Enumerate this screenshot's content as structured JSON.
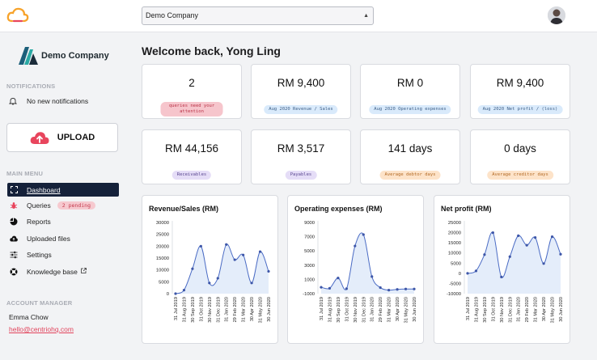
{
  "topbar": {
    "company_select_value": "Demo Company"
  },
  "sidebar": {
    "brand_name": "Demo Company",
    "notifications_label": "NOTIFICATIONS",
    "notification_text": "No new notifications",
    "upload_label": "UPLOAD",
    "main_menu_label": "MAIN MENU",
    "menu": [
      {
        "label": "Dashboard",
        "icon": "dashboard-icon"
      },
      {
        "label": "Queries",
        "icon": "bug-icon",
        "badge": "2 pending"
      },
      {
        "label": "Reports",
        "icon": "pie-chart-icon"
      },
      {
        "label": "Uploaded files",
        "icon": "cloud-icon"
      },
      {
        "label": "Settings",
        "icon": "sliders-icon"
      },
      {
        "label": "Knowledge base",
        "icon": "help-icon"
      }
    ],
    "account_manager_label": "ACCOUNT MANAGER",
    "manager_name": "Emma Chow",
    "manager_email": "hello@centriohq.com"
  },
  "welcome": "Welcome back, Yong Ling",
  "kpis": [
    {
      "value": "2",
      "tag": "queries need your attention",
      "color": "#f6c5cc"
    },
    {
      "value": "RM 9,400",
      "tag": "Aug 2020 Revenue / Sales",
      "color": "#d9eafb"
    },
    {
      "value": "RM 0",
      "tag": "Aug 2020 Operating expenses",
      "color": "#d9eafb"
    },
    {
      "value": "RM 9,400",
      "tag": "Aug 2020 Net profit / (loss)",
      "color": "#d9eafb"
    },
    {
      "value": "RM 44,156",
      "tag": "Receivables",
      "color": "#e5ddf7"
    },
    {
      "value": "RM 3,517",
      "tag": "Payables",
      "color": "#e5ddf7"
    },
    {
      "value": "141 days",
      "tag": "Average debtor days",
      "color": "#fde3c9"
    },
    {
      "value": "0 days",
      "tag": "Average creditor days",
      "color": "#fde3c9"
    }
  ],
  "chart_data": [
    {
      "type": "area",
      "title": "Revenue/Sales (RM)",
      "x": [
        "31 Jul 2019",
        "31 Aug 2019",
        "30 Sep 2019",
        "31 Oct 2019",
        "30 Nov 2019",
        "31 Dec 2019",
        "31 Jan 2020",
        "29 Feb 2020",
        "31 Mar 2020",
        "30 Apr 2020",
        "31 May 2020",
        "30 Jun 2020"
      ],
      "values": [
        0,
        1500,
        10500,
        20000,
        4500,
        6500,
        20700,
        14300,
        16300,
        4500,
        17700,
        9400
      ],
      "yticks": [
        0,
        5000,
        10000,
        15000,
        20000,
        25000,
        30000
      ],
      "ylim": [
        0,
        30000
      ],
      "color": "#4a6bc4"
    },
    {
      "type": "area",
      "title": "Operating expenses (RM)",
      "x": [
        "31 Jul 2019",
        "31 Aug 2019",
        "30 Sep 2019",
        "31 Oct 2019",
        "30 Nov 2019",
        "31 Dec 2019",
        "31 Jan 2020",
        "29 Feb 2020",
        "31 Mar 2020",
        "30 Apr 2020",
        "31 May 2020",
        "30 Jun 2020"
      ],
      "values": [
        -100,
        -250,
        1200,
        -300,
        5700,
        7300,
        1400,
        -150,
        -500,
        -400,
        -350,
        -350
      ],
      "yticks": [
        -1000,
        1000,
        3000,
        5000,
        7000,
        9000
      ],
      "ylim": [
        -1000,
        9000
      ],
      "color": "#4a6bc4"
    },
    {
      "type": "area",
      "title": "Net profit (RM)",
      "x": [
        "31 Jul 2019",
        "31 Aug 2019",
        "30 Sep 2019",
        "31 Oct 2019",
        "30 Nov 2019",
        "31 Dec 2019",
        "31 Jan 2020",
        "29 Feb 2020",
        "31 Mar 2020",
        "30 Apr 2020",
        "31 May 2020",
        "30 Jun 2020"
      ],
      "values": [
        0,
        1200,
        9200,
        20000,
        -1800,
        8200,
        18500,
        13800,
        17600,
        4800,
        18000,
        9400
      ],
      "yticks": [
        -10000,
        -5000,
        0,
        5000,
        10000,
        15000,
        20000,
        25000
      ],
      "ylim": [
        -10000,
        25000
      ],
      "color": "#4a6bc4"
    }
  ]
}
